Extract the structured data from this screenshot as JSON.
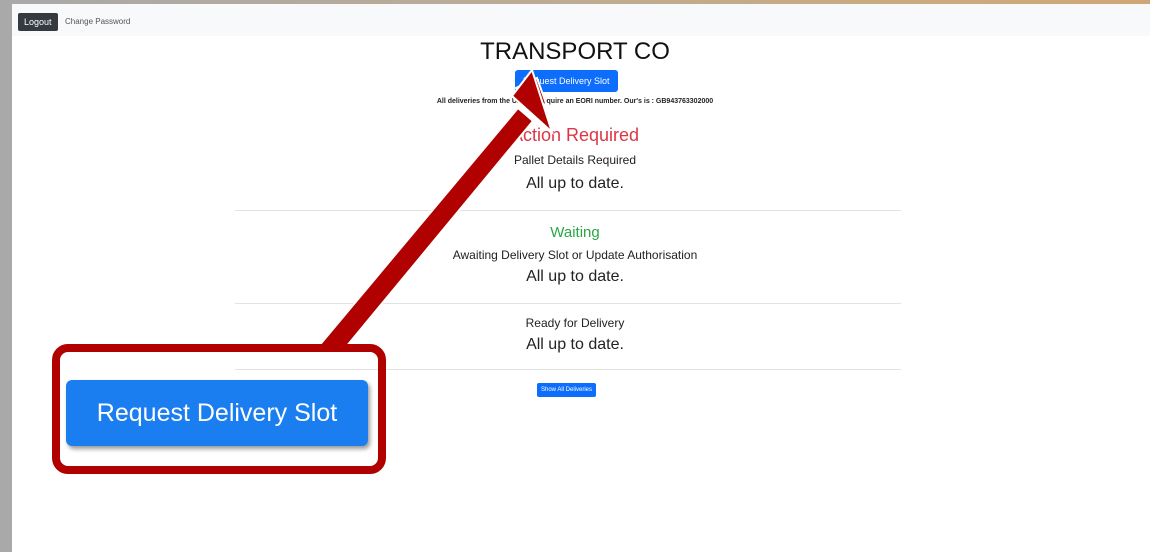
{
  "topbar": {
    "logout_label": "Logout",
    "change_password_label": "Change Password"
  },
  "page_title": "TRANSPORT CO",
  "request_button_label": "Request Delivery Slot",
  "eori_notice": "All deliveries from the UK now require an EORI number. Our's is : GB943763302000",
  "sections": [
    {
      "heading": "Action Required",
      "subheading": "Pallet Details Required",
      "status": "All up to date."
    },
    {
      "heading": "Waiting",
      "subheading": "Awaiting Delivery Slot or Update Authorisation",
      "status": "All up to date."
    },
    {
      "subheading": "Ready for Delivery",
      "status": "All up to date."
    }
  ],
  "show_all_label": "Show All Deliveries",
  "callout": {
    "button_label": "Request Delivery Slot"
  },
  "colors": {
    "primary": "#0d6efd",
    "danger": "#dc3545",
    "success": "#28a745",
    "callout_border": "#b00000"
  }
}
